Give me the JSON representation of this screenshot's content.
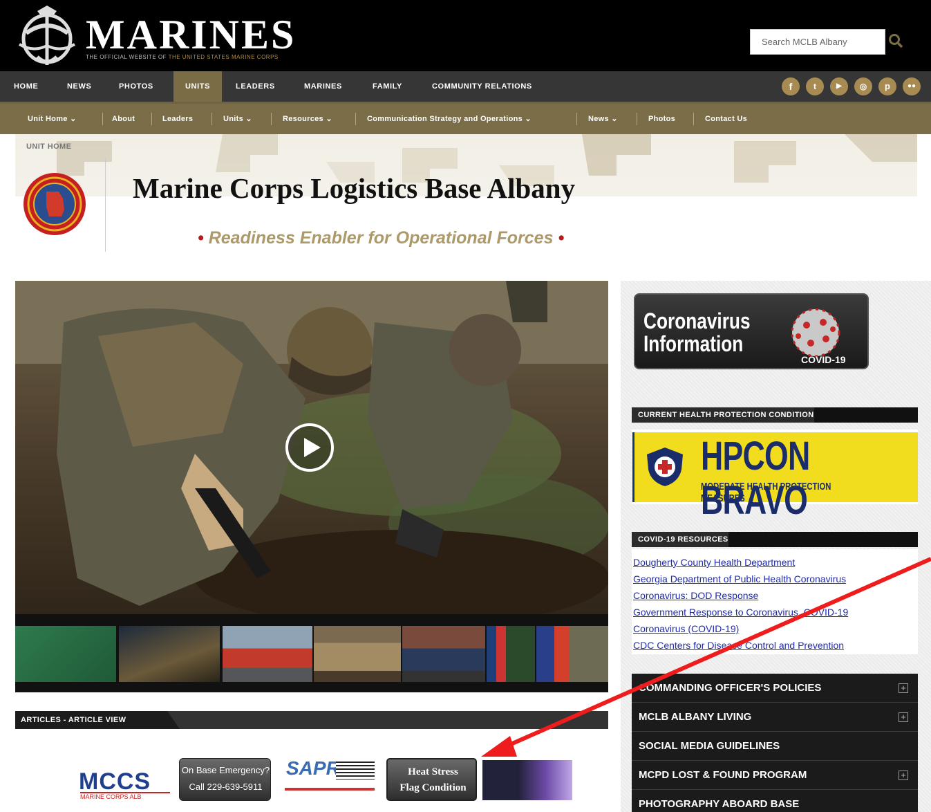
{
  "header": {
    "brand": "MARINES",
    "tagline_prefix": "THE OFFICIAL WEBSITE OF",
    "tagline_highlight": "THE UNITED STATES MARINE CORPS",
    "search_placeholder": "Search MCLB Albany",
    "search_icon": "search-icon"
  },
  "main_nav": {
    "items": [
      "HOME",
      "NEWS",
      "PHOTOS",
      "UNITS",
      "LEADERS",
      "MARINES",
      "FAMILY",
      "COMMUNITY RELATIONS"
    ],
    "active": "UNITS",
    "social_icons": [
      "facebook-icon",
      "twitter-icon",
      "youtube-icon",
      "instagram-icon",
      "pinterest-icon",
      "flickr-icon"
    ]
  },
  "sub_nav": {
    "items": [
      "Unit Home",
      "About",
      "Leaders",
      "Units",
      "Resources",
      "Communication Strategy and Operations",
      "News",
      "Photos",
      "Contact Us"
    ]
  },
  "banner": {
    "breadcrumb": "UNIT HOME",
    "title": "Marine Corps Logistics Base Albany",
    "subtitle": "Readiness Enabler for Operational Forces",
    "subtitle_bullet": "•"
  },
  "articles": {
    "section_label": "ARTICLES - ARTICLE VIEW",
    "banners": {
      "mccs": "MCCS",
      "mccs_sub": "MARINE CORPS ALB",
      "emergency_line1": "On Base Emergency?",
      "emergency_line2": "Call 229-639-5911",
      "sapr": "SAPR",
      "heat_line1": "Heat Stress",
      "heat_line2": "Flag Condition"
    }
  },
  "sidebar": {
    "covid_title_line1": "Coronavirus",
    "covid_title_line2": "Information",
    "covid_tag": "COVID-19",
    "hpcon_header": "CURRENT HEALTH PROTECTION CONDITION",
    "hpcon_big": "HPCON BRAVO",
    "hpcon_small": "MODERATE HEALTH PROTECTION MEASURES",
    "resources_header": "COVID-19 RESOURCES",
    "resource_links": [
      "Dougherty County Health Department",
      "Georgia Department of Public Health Coronavirus",
      "Coronavirus: DOD Response",
      "Government Response to Coronavirus, COVID-19",
      "Coronavirus (COVID-19)",
      "CDC Centers for Disease Control and Prevention"
    ],
    "menu": [
      {
        "label": "COMMANDING OFFICER'S POLICIES",
        "expandable": true
      },
      {
        "label": "MCLB ALBANY LIVING",
        "expandable": true
      },
      {
        "label": "SOCIAL MEDIA GUIDELINES",
        "expandable": false
      },
      {
        "label": "MCPD LOST & FOUND PROGRAM",
        "expandable": true
      },
      {
        "label": "PHOTOGRAPHY ABOARD BASE",
        "expandable": false
      }
    ],
    "expand_glyph": "+"
  },
  "hero": {
    "play_icon": "play-icon"
  },
  "colors": {
    "nav_dark": "#363636",
    "subnav_olive": "#7a6d48",
    "accent_gold": "#ad9a6a",
    "link_blue": "#1f2bb0",
    "annotation_red": "#ee1c1c"
  }
}
